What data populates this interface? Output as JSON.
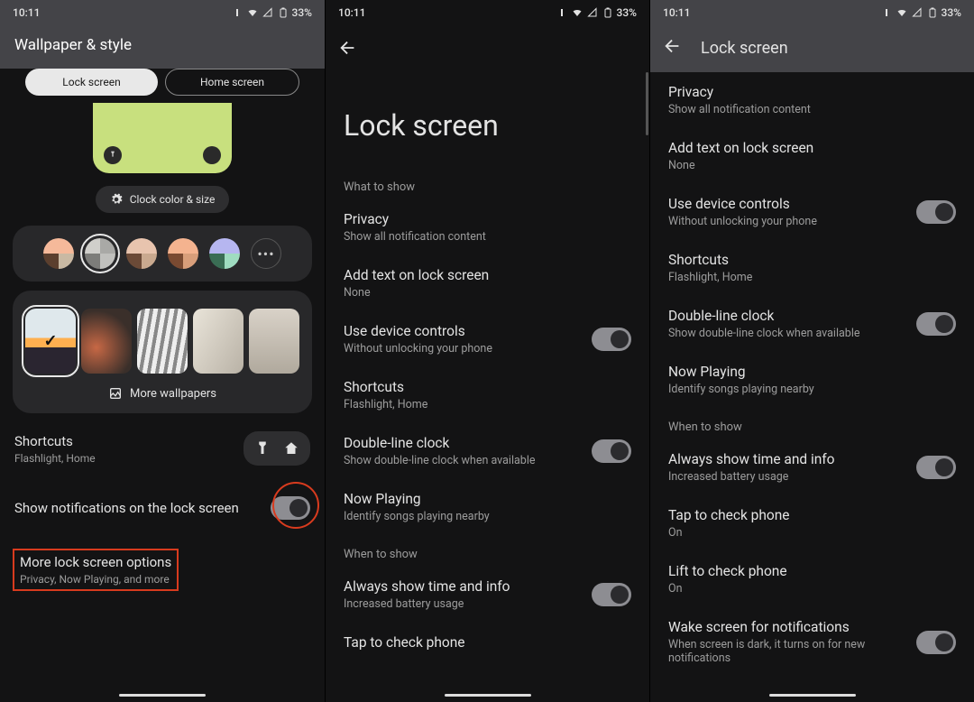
{
  "status": {
    "time": "10:11",
    "battery": "33%"
  },
  "panel1": {
    "title": "Wallpaper & style",
    "tabs": {
      "lock": "Lock screen",
      "home": "Home screen"
    },
    "clock_btn": "Clock color & size",
    "more_wallpapers": "More wallpapers",
    "shortcuts": {
      "title": "Shortcuts",
      "sub": "Flashlight, Home"
    },
    "show_notif": "Show notifications on the lock screen",
    "more_options": {
      "title": "More lock screen options",
      "sub": "Privacy, Now Playing, and more"
    }
  },
  "panel2": {
    "title": "Lock screen",
    "sections": {
      "what": "What to show",
      "when": "When to show"
    },
    "items": {
      "privacy": {
        "t": "Privacy",
        "s": "Show all notification content"
      },
      "addtext": {
        "t": "Add text on lock screen",
        "s": "None"
      },
      "device": {
        "t": "Use device controls",
        "s": "Without unlocking your phone"
      },
      "shortcuts": {
        "t": "Shortcuts",
        "s": "Flashlight, Home"
      },
      "dline": {
        "t": "Double-line clock",
        "s": "Show double-line clock when available"
      },
      "nowp": {
        "t": "Now Playing",
        "s": "Identify songs playing nearby"
      },
      "always": {
        "t": "Always show time and info",
        "s": "Increased battery usage"
      },
      "tap": {
        "t": "Tap to check phone"
      }
    }
  },
  "panel3": {
    "title": "Lock screen",
    "sections": {
      "when": "When to show"
    },
    "items": {
      "privacy": {
        "t": "Privacy",
        "s": "Show all notification content"
      },
      "addtext": {
        "t": "Add text on lock screen",
        "s": "None"
      },
      "device": {
        "t": "Use device controls",
        "s": "Without unlocking your phone"
      },
      "shortcuts": {
        "t": "Shortcuts",
        "s": "Flashlight, Home"
      },
      "dline": {
        "t": "Double-line clock",
        "s": "Show double-line clock when available"
      },
      "nowp": {
        "t": "Now Playing",
        "s": "Identify songs playing nearby"
      },
      "always": {
        "t": "Always show time and info",
        "s": "Increased battery usage"
      },
      "tap": {
        "t": "Tap to check phone",
        "s": "On"
      },
      "lift": {
        "t": "Lift to check phone",
        "s": "On"
      },
      "wake": {
        "t": "Wake screen for notifications",
        "s": "When screen is dark, it turns on for new notifications"
      }
    }
  },
  "colors": {
    "swatches": [
      {
        "tl": "#f5b99a",
        "tr": "#f5b99a",
        "bl": "#5b3f2e",
        "br": "#c9b9a3"
      },
      {
        "tl": "#d0cfcb",
        "tr": "#a9a9a6",
        "bl": "#7d7d7a",
        "br": "#c0c0bd"
      },
      {
        "tl": "#e8c4ae",
        "tr": "#e8c4ae",
        "bl": "#6b4a37",
        "br": "#c9a98f"
      },
      {
        "tl": "#f4b38f",
        "tr": "#f4b38f",
        "bl": "#7a4a31",
        "br": "#d89e7a"
      },
      {
        "tl": "#b6b6f0",
        "tr": "#b6b6f0",
        "bl": "#3a6d54",
        "br": "#9fdcc0"
      }
    ]
  }
}
